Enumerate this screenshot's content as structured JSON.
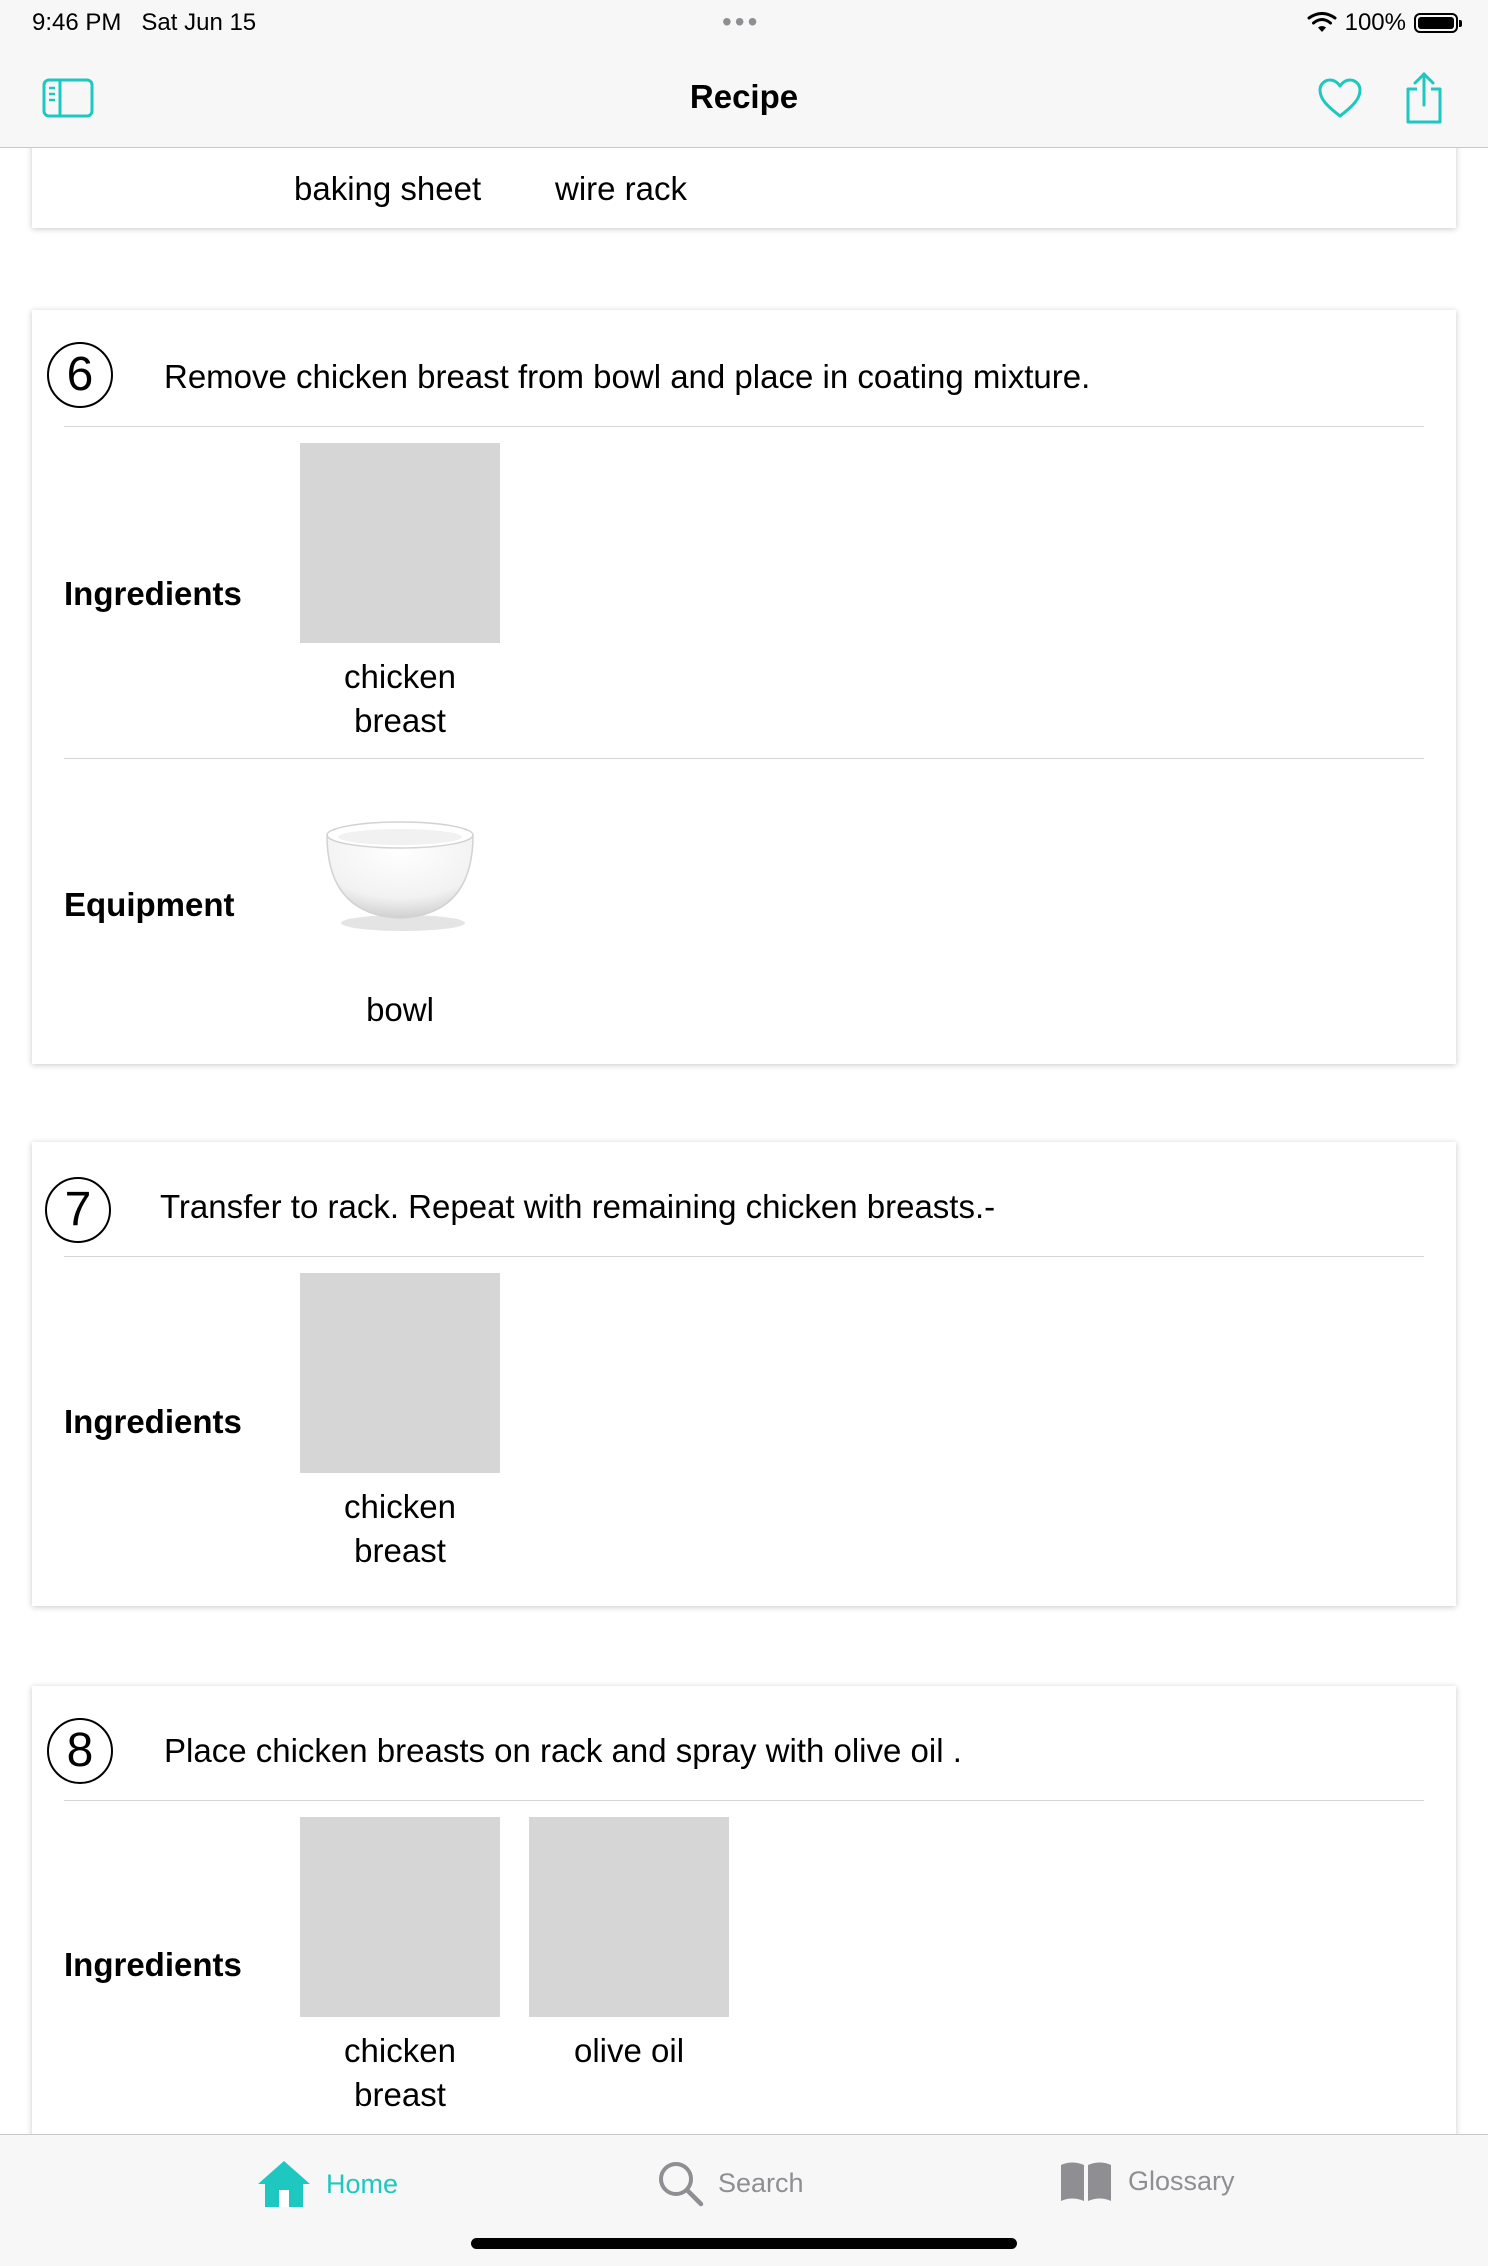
{
  "status_bar": {
    "time": "9:46 PM",
    "date": "Sat Jun 15",
    "battery": "100%"
  },
  "nav": {
    "title": "Recipe"
  },
  "colors": {
    "accent": "#1ec8c0",
    "inactive": "#8e8e93",
    "thumb_placeholder": "#d6d6d6"
  },
  "prev_card": {
    "equipment": [
      "baking sheet",
      "wire rack"
    ]
  },
  "steps": [
    {
      "number": "6",
      "text": "Remove chicken breast from bowl and place in coating mixture.",
      "ingredients_label": "Ingredients",
      "ingredients": [
        "chicken breast"
      ],
      "equipment_label": "Equipment",
      "equipment": [
        "bowl"
      ]
    },
    {
      "number": "7",
      "text": "Transfer to rack. Repeat with remaining chicken breasts.-",
      "ingredients_label": "Ingredients",
      "ingredients": [
        "chicken breast"
      ]
    },
    {
      "number": "8",
      "text": "Place chicken breasts on rack and spray with olive oil .",
      "ingredients_label": "Ingredients",
      "ingredients": [
        "chicken breast",
        "olive oil"
      ]
    }
  ],
  "tabs": [
    {
      "label": "Home",
      "icon": "house-icon",
      "active": true
    },
    {
      "label": "Search",
      "icon": "magnifier-icon",
      "active": false
    },
    {
      "label": "Glossary",
      "icon": "book-icon",
      "active": false
    }
  ]
}
